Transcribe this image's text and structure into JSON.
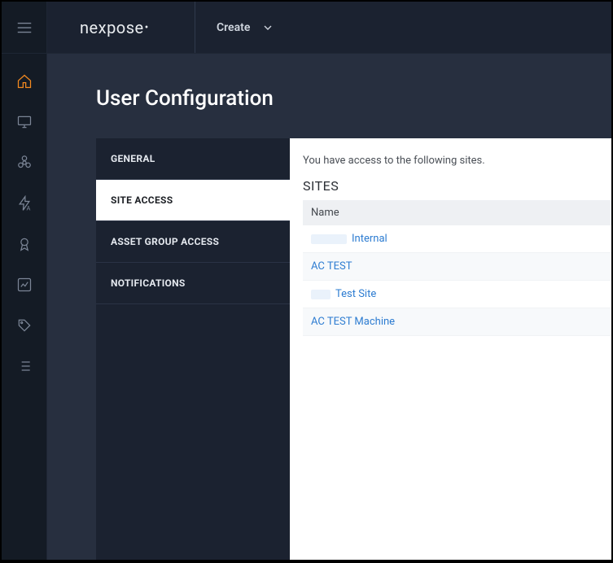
{
  "brand": {
    "name": "nexpose"
  },
  "topbar": {
    "create_label": "Create"
  },
  "page": {
    "title": "User Configuration"
  },
  "tabs": [
    {
      "label": "GENERAL",
      "key": "general",
      "active": false
    },
    {
      "label": "SITE ACCESS",
      "key": "site-access",
      "active": true
    },
    {
      "label": "ASSET GROUP ACCESS",
      "key": "asset-group",
      "active": false
    },
    {
      "label": "NOTIFICATIONS",
      "key": "notifications",
      "active": false
    }
  ],
  "site_access": {
    "intro": "You have access to the following sites.",
    "section_title": "SITES",
    "table": {
      "column_header": "Name",
      "rows": [
        {
          "label": "Internal",
          "redacted_prefix": true
        },
        {
          "label": "AC TEST",
          "redacted_prefix": false
        },
        {
          "label": "Test Site",
          "redacted_prefix": true,
          "redact_small": true
        },
        {
          "label": "AC TEST Machine",
          "redacted_prefix": false
        }
      ]
    }
  },
  "rail": {
    "items": [
      {
        "icon": "home",
        "active": true
      },
      {
        "icon": "monitor",
        "active": false
      },
      {
        "icon": "biohazard",
        "active": false
      },
      {
        "icon": "lightning",
        "active": false
      },
      {
        "icon": "award",
        "active": false
      },
      {
        "icon": "chart",
        "active": false
      },
      {
        "icon": "tag",
        "active": false
      },
      {
        "icon": "list",
        "active": false
      }
    ]
  }
}
